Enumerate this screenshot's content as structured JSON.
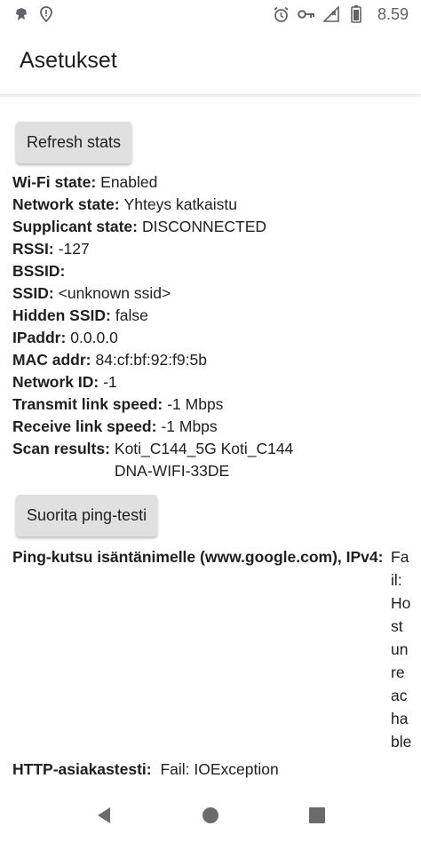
{
  "status_bar": {
    "time": "8.59",
    "icons_left": [
      "bug-icon",
      "location-icon"
    ],
    "icons_right": [
      "alarm-icon",
      "key-icon",
      "signal-icon",
      "battery-icon"
    ]
  },
  "app_bar": {
    "title": "Asetukset"
  },
  "refresh_button": {
    "label": "Refresh stats"
  },
  "wifi_info": [
    {
      "key": "Wi-Fi state:",
      "value": "Enabled"
    },
    {
      "key": "Network state:",
      "value": "Yhteys katkaistu"
    },
    {
      "key": "Supplicant state:",
      "value": "DISCONNECTED"
    },
    {
      "key": "RSSI:",
      "value": "-127"
    },
    {
      "key": "BSSID:",
      "value": ""
    },
    {
      "key": "SSID:",
      "value": "<unknown ssid>"
    },
    {
      "key": "Hidden SSID:",
      "value": "false"
    },
    {
      "key": "IPaddr:",
      "value": "0.0.0.0"
    },
    {
      "key": "MAC addr:",
      "value": "84:cf:bf:92:f9:5b"
    },
    {
      "key": "Network ID:",
      "value": "-1"
    },
    {
      "key": "Transmit link speed:",
      "value": "-1 Mbps"
    },
    {
      "key": "Receive link speed:",
      "value": "-1 Mbps"
    },
    {
      "key": "Scan results:",
      "value_line1": "Koti_C144_5G Koti_C144",
      "value_line2": "DNA-WIFI-33DE"
    }
  ],
  "ping_button": {
    "label": "Suorita ping-testi"
  },
  "ping_result": {
    "key": "Ping-kutsu isäntänimelle (www.google.com), IPv4:",
    "value": "Fail: Host unreachable"
  },
  "http_result": {
    "key": "HTTP-asiakastesti:",
    "value": "Fail: IOException"
  },
  "nav_bar": {
    "icons": [
      "back-icon",
      "home-icon",
      "recents-icon"
    ]
  }
}
